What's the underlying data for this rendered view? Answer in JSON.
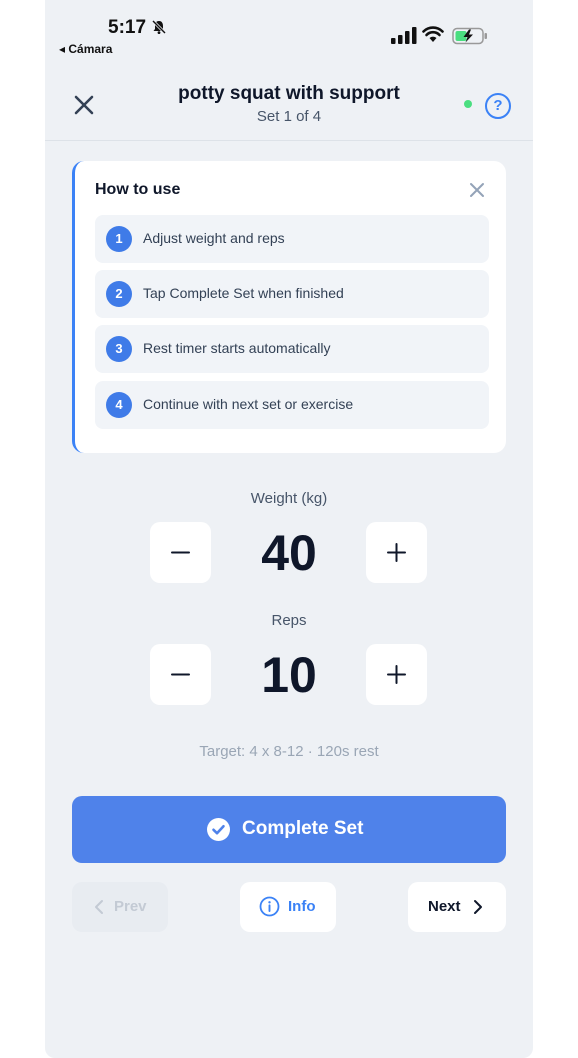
{
  "status_bar": {
    "time": "5:17",
    "back_app": "◂ Cámara"
  },
  "header": {
    "title": "potty squat with support",
    "subtitle": "Set 1 of 4",
    "help_label": "?"
  },
  "how_to": {
    "title": "How to use",
    "steps": [
      {
        "num": "1",
        "text": "Adjust weight and reps"
      },
      {
        "num": "2",
        "text": "Tap Complete Set when finished"
      },
      {
        "num": "3",
        "text": "Rest timer starts automatically"
      },
      {
        "num": "4",
        "text": "Continue with next set or exercise"
      }
    ]
  },
  "weight": {
    "label": "Weight (kg)",
    "value": "40"
  },
  "reps": {
    "label": "Reps",
    "value": "10"
  },
  "target": "Target: 4 x 8-12 · 120s rest",
  "complete_label": "Complete Set",
  "nav": {
    "prev": "Prev",
    "info": "Info",
    "next": "Next"
  },
  "colors": {
    "accent": "#4f82ea",
    "status_dot": "#4ade80",
    "background": "#eef1f5"
  }
}
